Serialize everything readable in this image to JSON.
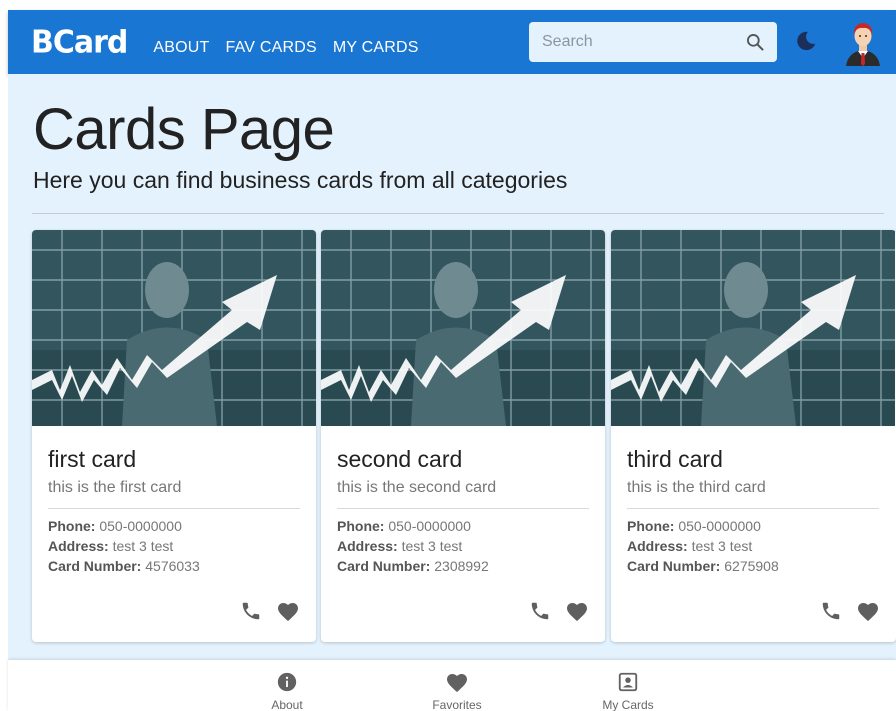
{
  "header": {
    "logo": "BCard",
    "nav": [
      "ABOUT",
      "FAV CARDS",
      "MY CARDS"
    ],
    "search_placeholder": "Search",
    "icons": [
      "search-icon",
      "moon-icon",
      "avatar"
    ]
  },
  "page": {
    "title": "Cards Page",
    "subtitle": "Here you can find business cards from all categories"
  },
  "cards": [
    {
      "title": "first card",
      "subtitle": "this is the first card",
      "phone_label": "Phone:",
      "phone": "050-0000000",
      "address_label": "Address:",
      "address": "test 3 test",
      "number_label": "Card Number:",
      "number": "4576033"
    },
    {
      "title": "second card",
      "subtitle": "this is the second card",
      "phone_label": "Phone:",
      "phone": "050-0000000",
      "address_label": "Address:",
      "address": "test 3 test",
      "number_label": "Card Number:",
      "number": "2308992"
    },
    {
      "title": "third card",
      "subtitle": "this is the third card",
      "phone_label": "Phone:",
      "phone": "050-0000000",
      "address_label": "Address:",
      "address": "test 3 test",
      "number_label": "Card Number:",
      "number": "6275908"
    }
  ],
  "bottom_nav": [
    "About",
    "Favorites",
    "My Cards"
  ],
  "colors": {
    "primary": "#1976d2",
    "background": "#e3f2fd",
    "search_bg": "#e3f2fd"
  }
}
